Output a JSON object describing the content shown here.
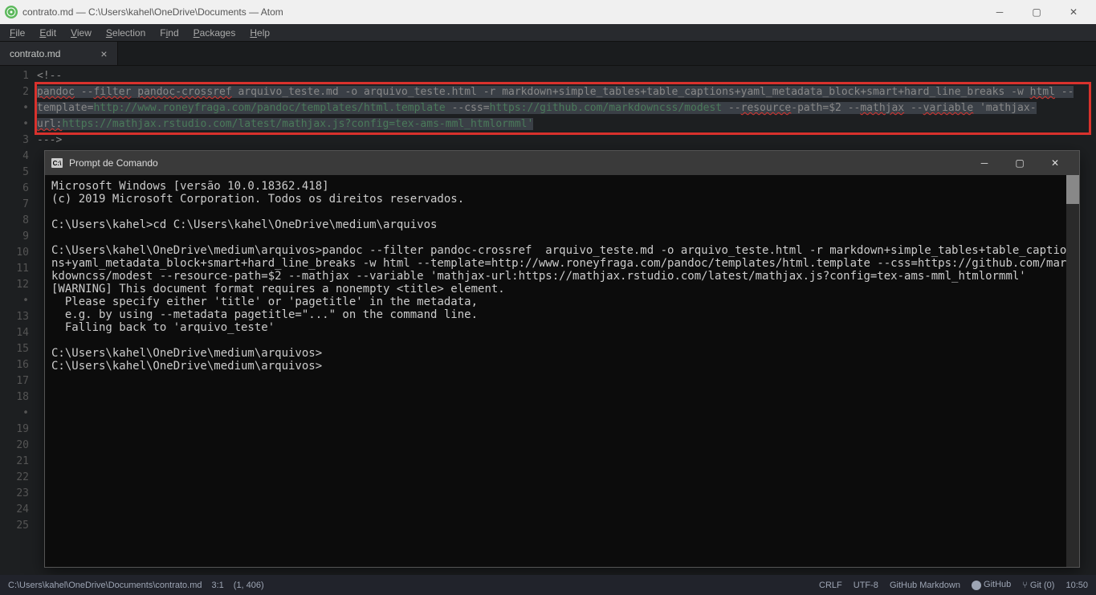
{
  "window": {
    "title": "contrato.md — C:\\Users\\kahel\\OneDrive\\Documents — Atom",
    "app_icon": "atom-icon"
  },
  "menu": {
    "file": "File",
    "edit": "Edit",
    "view": "View",
    "selection": "Selection",
    "find": "Find",
    "packages": "Packages",
    "help": "Help"
  },
  "tab": {
    "name": "contrato.md",
    "close": "×"
  },
  "gutter": [
    "1",
    "2",
    "•",
    "•",
    "3",
    "4",
    "5",
    "6",
    "7",
    "8",
    "9",
    "10",
    "11",
    "12",
    "•",
    "13",
    "14",
    "15",
    "16",
    "17",
    "18",
    "•",
    "19",
    "20",
    "21",
    "22",
    "23",
    "24",
    "25"
  ],
  "code": {
    "l1": "<!--",
    "l2a": "pandoc",
    "l2b": " --",
    "l2c": "filter",
    "l2d": " ",
    "l2e": "pandoc-crossref",
    "l2f": "  arquivo_teste.md -o arquivo_teste.html -r markdown+simple_tables+table_captions+yaml_metadata_block+smart+hard_line_breaks -w ",
    "l2g": "html",
    "l2h": " --",
    "l3a": "template=",
    "l3b": "http://www.roneyfraga.com/pandoc/templates/html.template",
    "l3c": " --css=",
    "l3d": "https://github.com/markdowncss/modest",
    "l3e": " --",
    "l3f": "resource",
    "l3g": "-path=$2 --",
    "l3h": "mathjax",
    "l3i": " --",
    "l3j": "variable",
    "l3k": " 'mathjax-",
    "l4a": "url:",
    "l4b": "https://mathjax.rstudio.com/latest/mathjax.js?config=tex-ams-mml_htmlormml'",
    "l5": "--->"
  },
  "cmd": {
    "title": "Prompt de Comando",
    "body": "Microsoft Windows [versão 10.0.18362.418]\n(c) 2019 Microsoft Corporation. Todos os direitos reservados.\n\nC:\\Users\\kahel>cd C:\\Users\\kahel\\OneDrive\\medium\\arquivos\n\nC:\\Users\\kahel\\OneDrive\\medium\\arquivos>pandoc --filter pandoc-crossref  arquivo_teste.md -o arquivo_teste.html -r markdown+simple_tables+table_captions+yaml_metadata_block+smart+hard_line_breaks -w html --template=http://www.roneyfraga.com/pandoc/templates/html.template --css=https://github.com/markdowncss/modest --resource-path=$2 --mathjax --variable 'mathjax-url:https://mathjax.rstudio.com/latest/mathjax.js?config=tex-ams-mml_htmlormml'\n[WARNING] This document format requires a nonempty <title> element.\n  Please specify either 'title' or 'pagetitle' in the metadata,\n  e.g. by using --metadata pagetitle=\"...\" on the command line.\n  Falling back to 'arquivo_teste'\n\nC:\\Users\\kahel\\OneDrive\\medium\\arquivos>\nC:\\Users\\kahel\\OneDrive\\medium\\arquivos>"
  },
  "status": {
    "path": "C:\\Users\\kahel\\OneDrive\\Documents\\contrato.md",
    "cursor": "3:1",
    "sel": "(1, 406)",
    "crlf": "CRLF",
    "encoding": "UTF-8",
    "grammar": "GitHub Markdown",
    "github": "GitHub",
    "git": "Git (0)",
    "clock": "10:50"
  }
}
